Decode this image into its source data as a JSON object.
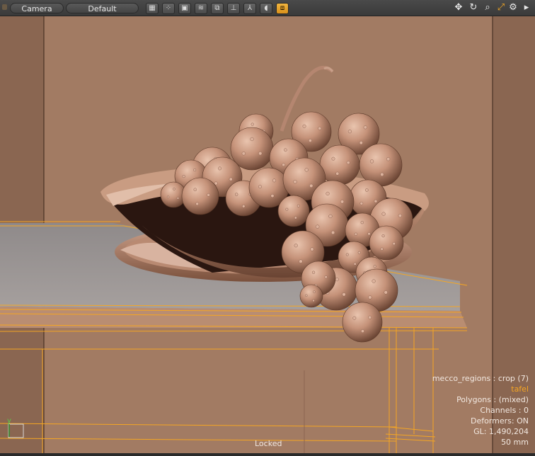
{
  "toolbar": {
    "camera_label": "Camera",
    "style_label": "Default",
    "view_buttons": [
      {
        "name": "checker-icon",
        "glyph": "▦"
      },
      {
        "name": "dots-grid-icon",
        "glyph": "⁘"
      },
      {
        "name": "texture-icon",
        "glyph": "▣"
      },
      {
        "name": "stripes-icon",
        "glyph": "≋"
      },
      {
        "name": "frame-icon",
        "glyph": "⧉"
      },
      {
        "name": "axes-icon",
        "glyph": "⊥"
      },
      {
        "name": "tripod-icon",
        "glyph": "⅄"
      },
      {
        "name": "backdrop-icon",
        "glyph": "◖"
      },
      {
        "name": "render-preview-icon",
        "glyph": "⧈",
        "active": true
      }
    ],
    "right_buttons": [
      {
        "name": "pan-icon",
        "glyph": "✥"
      },
      {
        "name": "rotate-icon",
        "glyph": "↻"
      },
      {
        "name": "zoom-icon",
        "glyph": "⌕"
      },
      {
        "name": "maximize-icon",
        "glyph": "⤢"
      },
      {
        "name": "settings-gear-icon",
        "glyph": "⚙"
      },
      {
        "name": "expand-arrow-icon",
        "glyph": "▸"
      }
    ]
  },
  "info": {
    "region": "mecco_regions : crop (7)",
    "item_name": "tafel",
    "polygons": "Polygons : (mixed)",
    "channels": "Channels : 0",
    "deformers": "Deformers: ON",
    "gl": "GL: 1,490,204",
    "focal": "50 mm"
  },
  "status": {
    "locked": "Locked"
  },
  "axis_label": "y",
  "colors": {
    "background": "#a27b63",
    "selection": "#f5a623",
    "grape": "#c49479",
    "bowl_inner": "#2a1610"
  }
}
